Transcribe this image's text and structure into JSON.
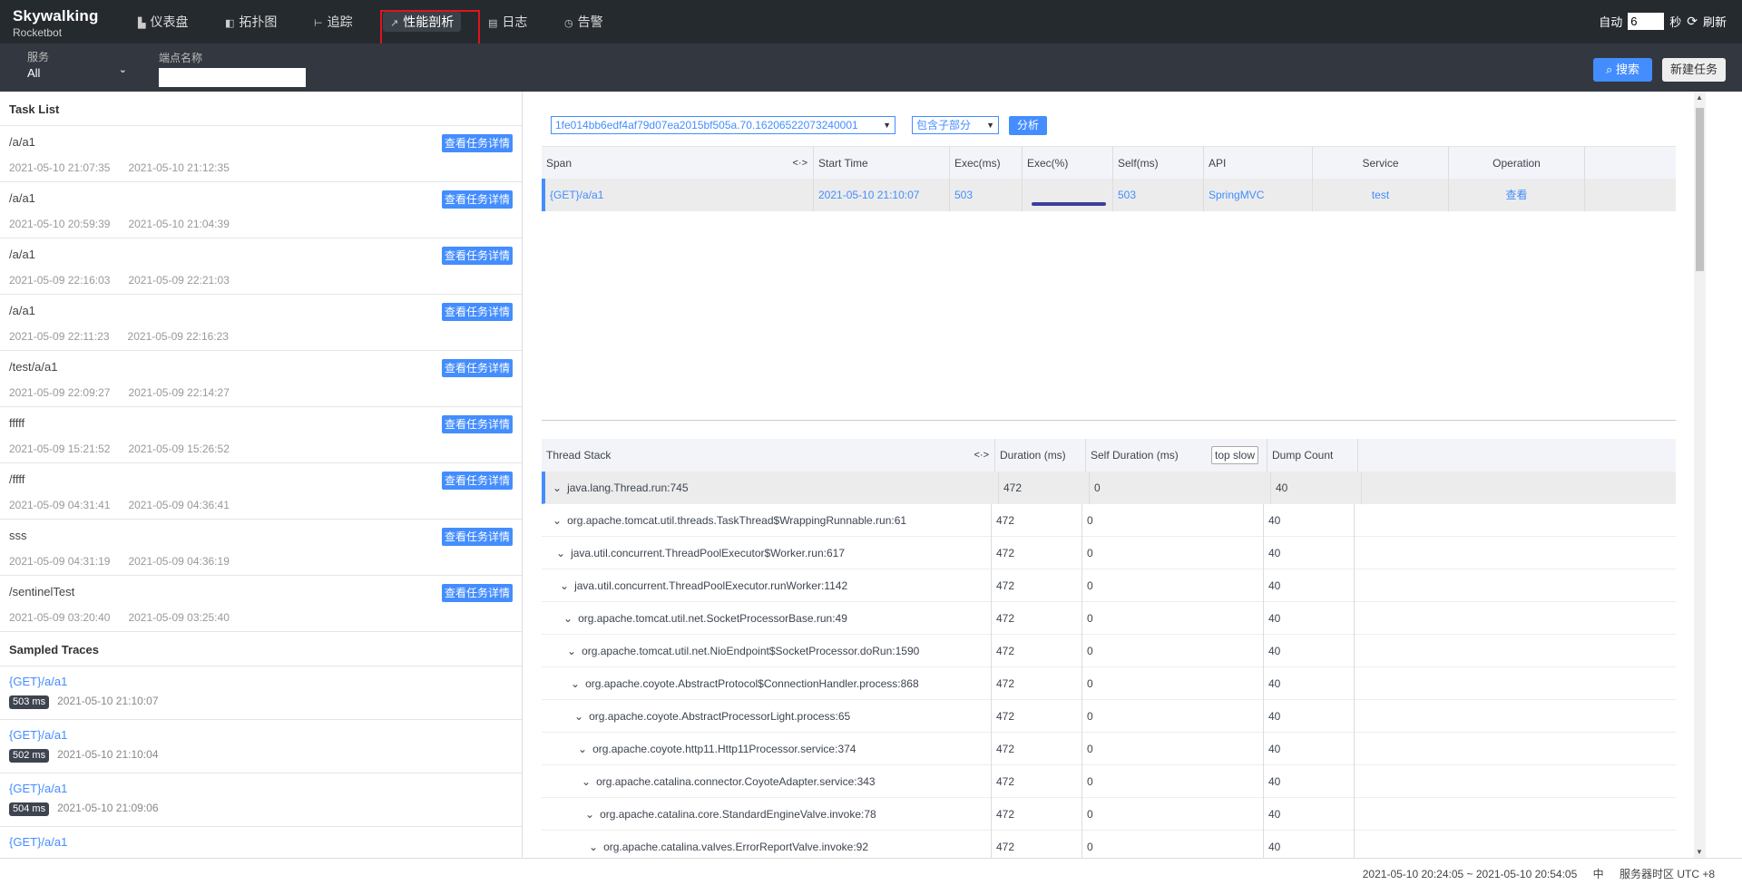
{
  "app": {
    "brand": "Skywalking",
    "sub_brand": "Rocketbot"
  },
  "nav": {
    "items": [
      {
        "label": "仪表盘",
        "icon": "dashboard-icon"
      },
      {
        "label": "拓扑图",
        "icon": "topology-icon"
      },
      {
        "label": "追踪",
        "icon": "trace-icon"
      },
      {
        "label": "性能剖析",
        "icon": "profile-icon",
        "active": true
      },
      {
        "label": "日志",
        "icon": "log-icon"
      },
      {
        "label": "告警",
        "icon": "alarm-icon"
      }
    ],
    "auto_label": "自动",
    "interval_value": "6",
    "seconds_label": "秒",
    "refresh_label": "刷新"
  },
  "filter": {
    "service_label": "服务",
    "service_value": "All",
    "endpoint_label": "端点名称",
    "endpoint_value": "",
    "search_label": "搜索",
    "new_task_label": "新建任务"
  },
  "task_list": {
    "title": "Task List",
    "detail_label": "查看任务详情",
    "tasks": [
      {
        "name": "/a/a1",
        "start": "2021-05-10 21:07:35",
        "end": "2021-05-10 21:12:35"
      },
      {
        "name": "/a/a1",
        "start": "2021-05-10 20:59:39",
        "end": "2021-05-10 21:04:39"
      },
      {
        "name": "/a/a1",
        "start": "2021-05-09 22:16:03",
        "end": "2021-05-09 22:21:03"
      },
      {
        "name": "/a/a1",
        "start": "2021-05-09 22:11:23",
        "end": "2021-05-09 22:16:23"
      },
      {
        "name": "/test/a/a1",
        "start": "2021-05-09 22:09:27",
        "end": "2021-05-09 22:14:27"
      },
      {
        "name": "fffff",
        "start": "2021-05-09 15:21:52",
        "end": "2021-05-09 15:26:52"
      },
      {
        "name": "/ffff",
        "start": "2021-05-09 04:31:41",
        "end": "2021-05-09 04:36:41"
      },
      {
        "name": "sss",
        "start": "2021-05-09 04:31:19",
        "end": "2021-05-09 04:36:19"
      },
      {
        "name": "/sentinelTest",
        "start": "2021-05-09 03:20:40",
        "end": "2021-05-09 03:25:40"
      }
    ]
  },
  "sampled_traces": {
    "title": "Sampled Traces",
    "traces": [
      {
        "name": "{GET}/a/a1",
        "duration": "503 ms",
        "time": "2021-05-10 21:10:07"
      },
      {
        "name": "{GET}/a/a1",
        "duration": "502 ms",
        "time": "2021-05-10 21:10:04"
      },
      {
        "name": "{GET}/a/a1",
        "duration": "504 ms",
        "time": "2021-05-10 21:09:06"
      },
      {
        "name": "{GET}/a/a1",
        "duration": "",
        "time": ""
      }
    ]
  },
  "analysis": {
    "segment_id": "1fe014bb6edf4af79d07ea2015bf505a.70.16206522073240001",
    "mode": "包含子部分",
    "analyze_label": "分析"
  },
  "span_table": {
    "headers": [
      "Span",
      "Start Time",
      "Exec(ms)",
      "Exec(%)",
      "Self(ms)",
      "API",
      "Service",
      "Operation"
    ],
    "resize_glyph": "<·>",
    "rows": [
      {
        "span": "{GET}/a/a1",
        "start_time": "2021-05-10 21:10:07",
        "exec_ms": "503",
        "exec_pct": 1.0,
        "self_ms": "503",
        "api": "SpringMVC",
        "service": "test",
        "operation": "查看"
      }
    ]
  },
  "thread_stack": {
    "headers": [
      "Thread Stack",
      "Duration (ms)",
      "Self Duration (ms)",
      "Dump Count"
    ],
    "top_slow_label": "top slow",
    "rows": [
      {
        "frame": "java.lang.Thread.run:745",
        "duration": "472",
        "self": "0",
        "dump": "40"
      },
      {
        "frame": "org.apache.tomcat.util.threads.TaskThread$WrappingRunnable.run:61",
        "duration": "472",
        "self": "0",
        "dump": "40"
      },
      {
        "frame": "java.util.concurrent.ThreadPoolExecutor$Worker.run:617",
        "duration": "472",
        "self": "0",
        "dump": "40"
      },
      {
        "frame": "java.util.concurrent.ThreadPoolExecutor.runWorker:1142",
        "duration": "472",
        "self": "0",
        "dump": "40"
      },
      {
        "frame": "org.apache.tomcat.util.net.SocketProcessorBase.run:49",
        "duration": "472",
        "self": "0",
        "dump": "40"
      },
      {
        "frame": "org.apache.tomcat.util.net.NioEndpoint$SocketProcessor.doRun:1590",
        "duration": "472",
        "self": "0",
        "dump": "40"
      },
      {
        "frame": "org.apache.coyote.AbstractProtocol$ConnectionHandler.process:868",
        "duration": "472",
        "self": "0",
        "dump": "40"
      },
      {
        "frame": "org.apache.coyote.AbstractProcessorLight.process:65",
        "duration": "472",
        "self": "0",
        "dump": "40"
      },
      {
        "frame": "org.apache.coyote.http11.Http11Processor.service:374",
        "duration": "472",
        "self": "0",
        "dump": "40"
      },
      {
        "frame": "org.apache.catalina.connector.CoyoteAdapter.service:343",
        "duration": "472",
        "self": "0",
        "dump": "40"
      },
      {
        "frame": "org.apache.catalina.core.StandardEngineValve.invoke:78",
        "duration": "472",
        "self": "0",
        "dump": "40"
      },
      {
        "frame": "org.apache.catalina.valves.ErrorReportValve.invoke:92",
        "duration": "472",
        "self": "0",
        "dump": "40"
      }
    ]
  },
  "footer": {
    "time_range": "2021-05-10 20:24:05 ~ 2021-05-10 20:54:05",
    "lang": "中",
    "timezone_label": "服务器时区 UTC +8"
  },
  "colors": {
    "accent": "#448dfe",
    "topbar": "#252a2f",
    "filterbar": "#333840",
    "highlight": "#e0141e"
  }
}
